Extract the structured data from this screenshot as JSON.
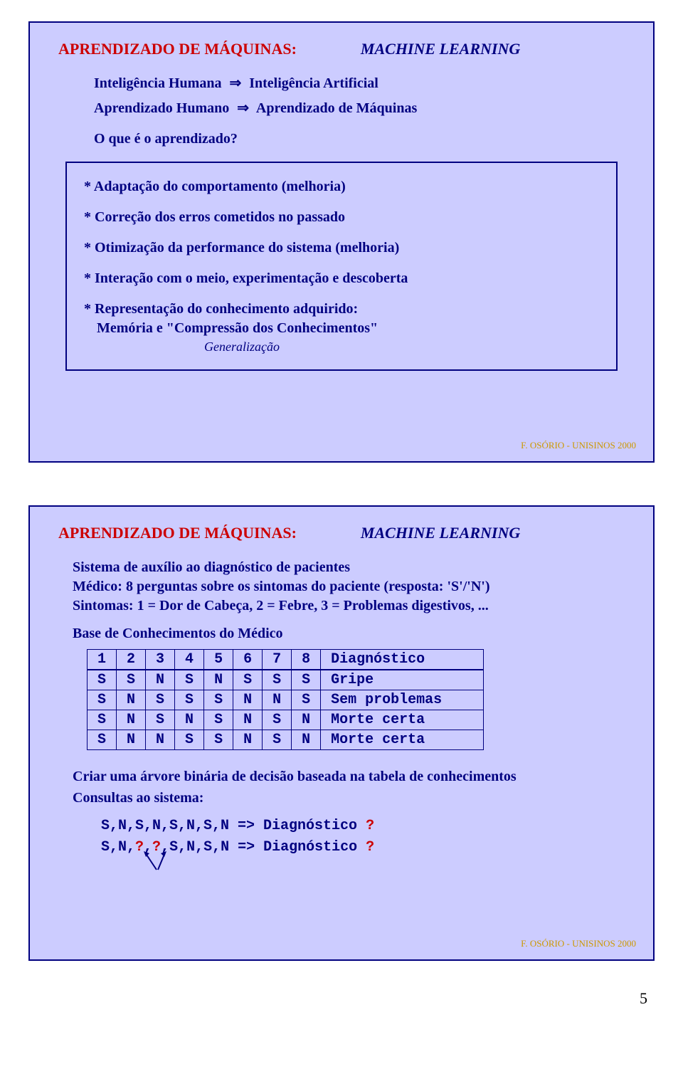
{
  "slide1": {
    "title_left": "APRENDIZADO DE MÁQUINAS:",
    "title_right": "MACHINE LEARNING",
    "row1_left": "Inteligência Humana",
    "row1_arrow": "⇒",
    "row1_right": "Inteligência Artificial",
    "row2_left": "Aprendizado Humano",
    "row2_arrow": "⇒",
    "row2_right": "Aprendizado de Máquinas",
    "question": "O que é  o aprendizado?",
    "b1": "* Adaptação do comportamento (melhoria)",
    "b2": "* Correção dos erros cometidos no passado",
    "b3": "* Otimização da performance do sistema (melhoria)",
    "b4": "* Interação com o meio, experimentação e descoberta",
    "b5": "* Representação do conhecimento adquirido:",
    "b5_sub": "Memória  e  \"Compressão dos Conhecimentos\"",
    "b5_subit": "Generalização",
    "footer": "F. OSÓRIO - UNISINOS 2000"
  },
  "slide2": {
    "title_left": "APRENDIZADO DE MÁQUINAS:",
    "title_right": "MACHINE LEARNING",
    "desc_l1": "Sistema de auxílio ao diagnóstico de pacientes",
    "desc_l2": "Médico:    8 perguntas sobre os sintomas do paciente (resposta: 'S'/'N')",
    "desc_l3": "Sintomas: 1 = Dor de Cabeça, 2 = Febre, 3 = Problemas digestivos, ...",
    "kb_title": "Base de Conhecimentos do Médico",
    "table": {
      "headers": [
        "1",
        "2",
        "3",
        "4",
        "5",
        "6",
        "7",
        "8",
        "Diagnóstico"
      ],
      "rows": [
        [
          "S",
          "S",
          "N",
          "S",
          "N",
          "S",
          "S",
          "S",
          "Gripe"
        ],
        [
          "S",
          "N",
          "S",
          "S",
          "S",
          "N",
          "N",
          "S",
          "Sem problemas"
        ],
        [
          "S",
          "N",
          "S",
          "N",
          "S",
          "N",
          "S",
          "N",
          "Morte certa"
        ],
        [
          "S",
          "N",
          "N",
          "S",
          "S",
          "N",
          "S",
          "N",
          "Morte certa"
        ]
      ]
    },
    "after_l1": "Criar uma árvore binária de decisão baseada na tabela de conhecimentos",
    "after_l2": "Consultas ao sistema:",
    "q1_a": "S,N,S,N,S,N,S,N => Diagnóstico ",
    "q1_b": "?",
    "q2_a": "S,N,",
    "q2_b": "?",
    "q2_c": ",",
    "q2_d": "?",
    "q2_e": ",S,N,S,N => Diagnóstico ",
    "q2_f": "?",
    "footer": "F. OSÓRIO - UNISINOS 2000"
  },
  "pagenum": "5"
}
